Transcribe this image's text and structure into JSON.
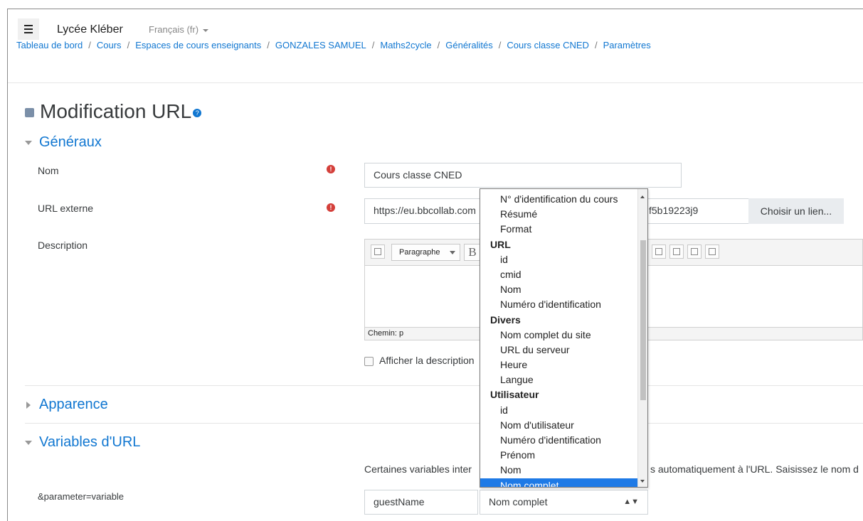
{
  "navbar": {
    "brand": "Lycée Kléber",
    "language": "Français (fr)"
  },
  "breadcrumb": [
    "Tableau de bord",
    "Cours",
    "Espaces de cours enseignants",
    "GONZALES SAMUEL",
    "Maths2cycle",
    "Généralités",
    "Cours classe CNED",
    "Paramètres"
  ],
  "page": {
    "title": "Modification URL",
    "help_icon": "?"
  },
  "sections": {
    "generaux": "Généraux",
    "apparence": "Apparence",
    "variables": "Variables d'URL"
  },
  "form": {
    "nom_label": "Nom",
    "nom_value": "Cours classe CNED",
    "url_label": "URL externe",
    "url_value_start": "https://eu.bbcollab.com",
    "url_value_end": "f5b19223j9",
    "choose_link": "Choisir un lien...",
    "description_label": "Description",
    "paragraph_select": "Paragraphe",
    "bold_label": "B",
    "editor_path": "Chemin: p",
    "show_description": "Afficher la description",
    "required_icon": "!",
    "variables_help_start": "Certaines variables inter",
    "variables_help_end": "s automatiquement à l'URL. Saisissez le nom d",
    "parameter_label": "&parameter=variable",
    "parameter_value": "guestName",
    "variable_selected": "Nom complet"
  },
  "dropdown": {
    "entries": [
      {
        "type": "item",
        "label": "N° d'identification du cours"
      },
      {
        "type": "item",
        "label": "Résumé"
      },
      {
        "type": "item",
        "label": "Format"
      },
      {
        "type": "group",
        "label": "URL"
      },
      {
        "type": "item",
        "label": "id"
      },
      {
        "type": "item",
        "label": "cmid"
      },
      {
        "type": "item",
        "label": "Nom"
      },
      {
        "type": "item",
        "label": "Numéro d'identification"
      },
      {
        "type": "group",
        "label": "Divers"
      },
      {
        "type": "item",
        "label": "Nom complet du site"
      },
      {
        "type": "item",
        "label": "URL du serveur"
      },
      {
        "type": "item",
        "label": "Heure"
      },
      {
        "type": "item",
        "label": "Langue"
      },
      {
        "type": "group",
        "label": "Utilisateur"
      },
      {
        "type": "item",
        "label": "id"
      },
      {
        "type": "item",
        "label": "Nom d'utilisateur"
      },
      {
        "type": "item",
        "label": "Numéro d'identification"
      },
      {
        "type": "item",
        "label": "Prénom"
      },
      {
        "type": "item",
        "label": "Nom"
      },
      {
        "type": "item",
        "label": "Nom complet",
        "selected": true
      }
    ]
  },
  "colors": {
    "link": "#1177d1",
    "required": "#d43f3a",
    "selection": "#1e7ae6"
  }
}
